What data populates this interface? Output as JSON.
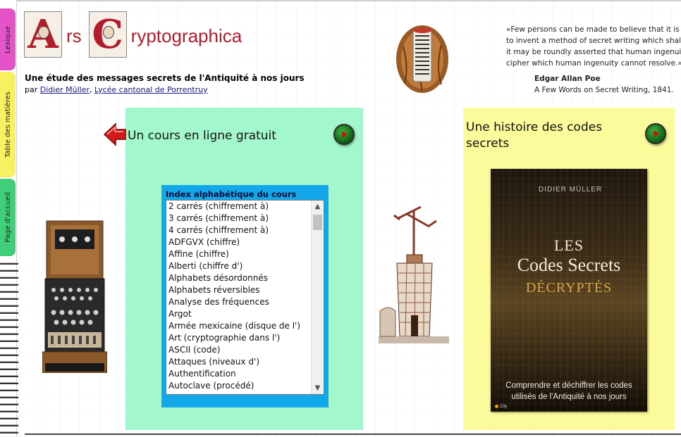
{
  "tabs": {
    "lexique": "Lexique",
    "table": "Table des matières",
    "accueil": "Page d'accueil"
  },
  "header": {
    "logo_cap_1": "A",
    "logo_word_1": "rs",
    "logo_cap_2": "C",
    "logo_word_2": "ryptographica",
    "subtitle": "Une étude des messages secrets de l'Antiquité à nos jours",
    "byline_prefix": "par ",
    "author_link": "Didier Müller",
    "byline_sep": ", ",
    "school_link": "Lycée cantonal de Porrentruy"
  },
  "quote": {
    "line1": "«Few persons can be made to believe that it is not",
    "line2": "to invent a method of secret writing which shall baffle",
    "line3": "it may be roundly asserted that human ingenuity cannot",
    "line4": "cipher which human ingenuity cannot resolve.»",
    "author": "Edgar Allan Poe",
    "work": "A Few Words on Secret Writing, 1841."
  },
  "course_panel": {
    "title": "Un cours en ligne gratuit",
    "index_title": "Index alphabétique du cours",
    "items": [
      "2 carrés (chiffrement à)",
      "3 carrés (chiffrement à)",
      "4 carrés (chiffrement à)",
      "ADFGVX (chiffre)",
      "Affine (chiffre)",
      "Alberti (chiffre d')",
      "Alphabets désordonnés",
      "Alphabets réversibles",
      "Analyse des fréquences",
      "Argot",
      "Armée mexicaine (disque de l')",
      "Art (cryptographie dans l')",
      "ASCII (code)",
      "Attaques (niveaux d')",
      "Authentification",
      "Autoclave (procédé)"
    ]
  },
  "book_panel": {
    "title": "Une histoire des codes secrets",
    "cover_author": "DIDIER MÜLLER",
    "cover_les": "LES",
    "cover_codes": "Codes Secrets",
    "cover_decryptes": "DÉCRYPTÉS",
    "cover_tagline_1": "Comprendre et déchiffrer les codes",
    "cover_tagline_2": "utilisés de l'Antiquité à nos jours",
    "cover_publisher": "City"
  },
  "colors": {
    "logo_red": "#b31c2a",
    "course_panel_bg": "#a3f7cc",
    "book_panel_bg": "#fbfb9c",
    "index_box_bg": "#12a7e8",
    "tab_pink": "#e454c8",
    "tab_yellow": "#f7f060",
    "tab_green": "#3fcf7a"
  },
  "icons": {
    "back": "red-left-arrow-icon",
    "go": "green-play-button-icon"
  }
}
